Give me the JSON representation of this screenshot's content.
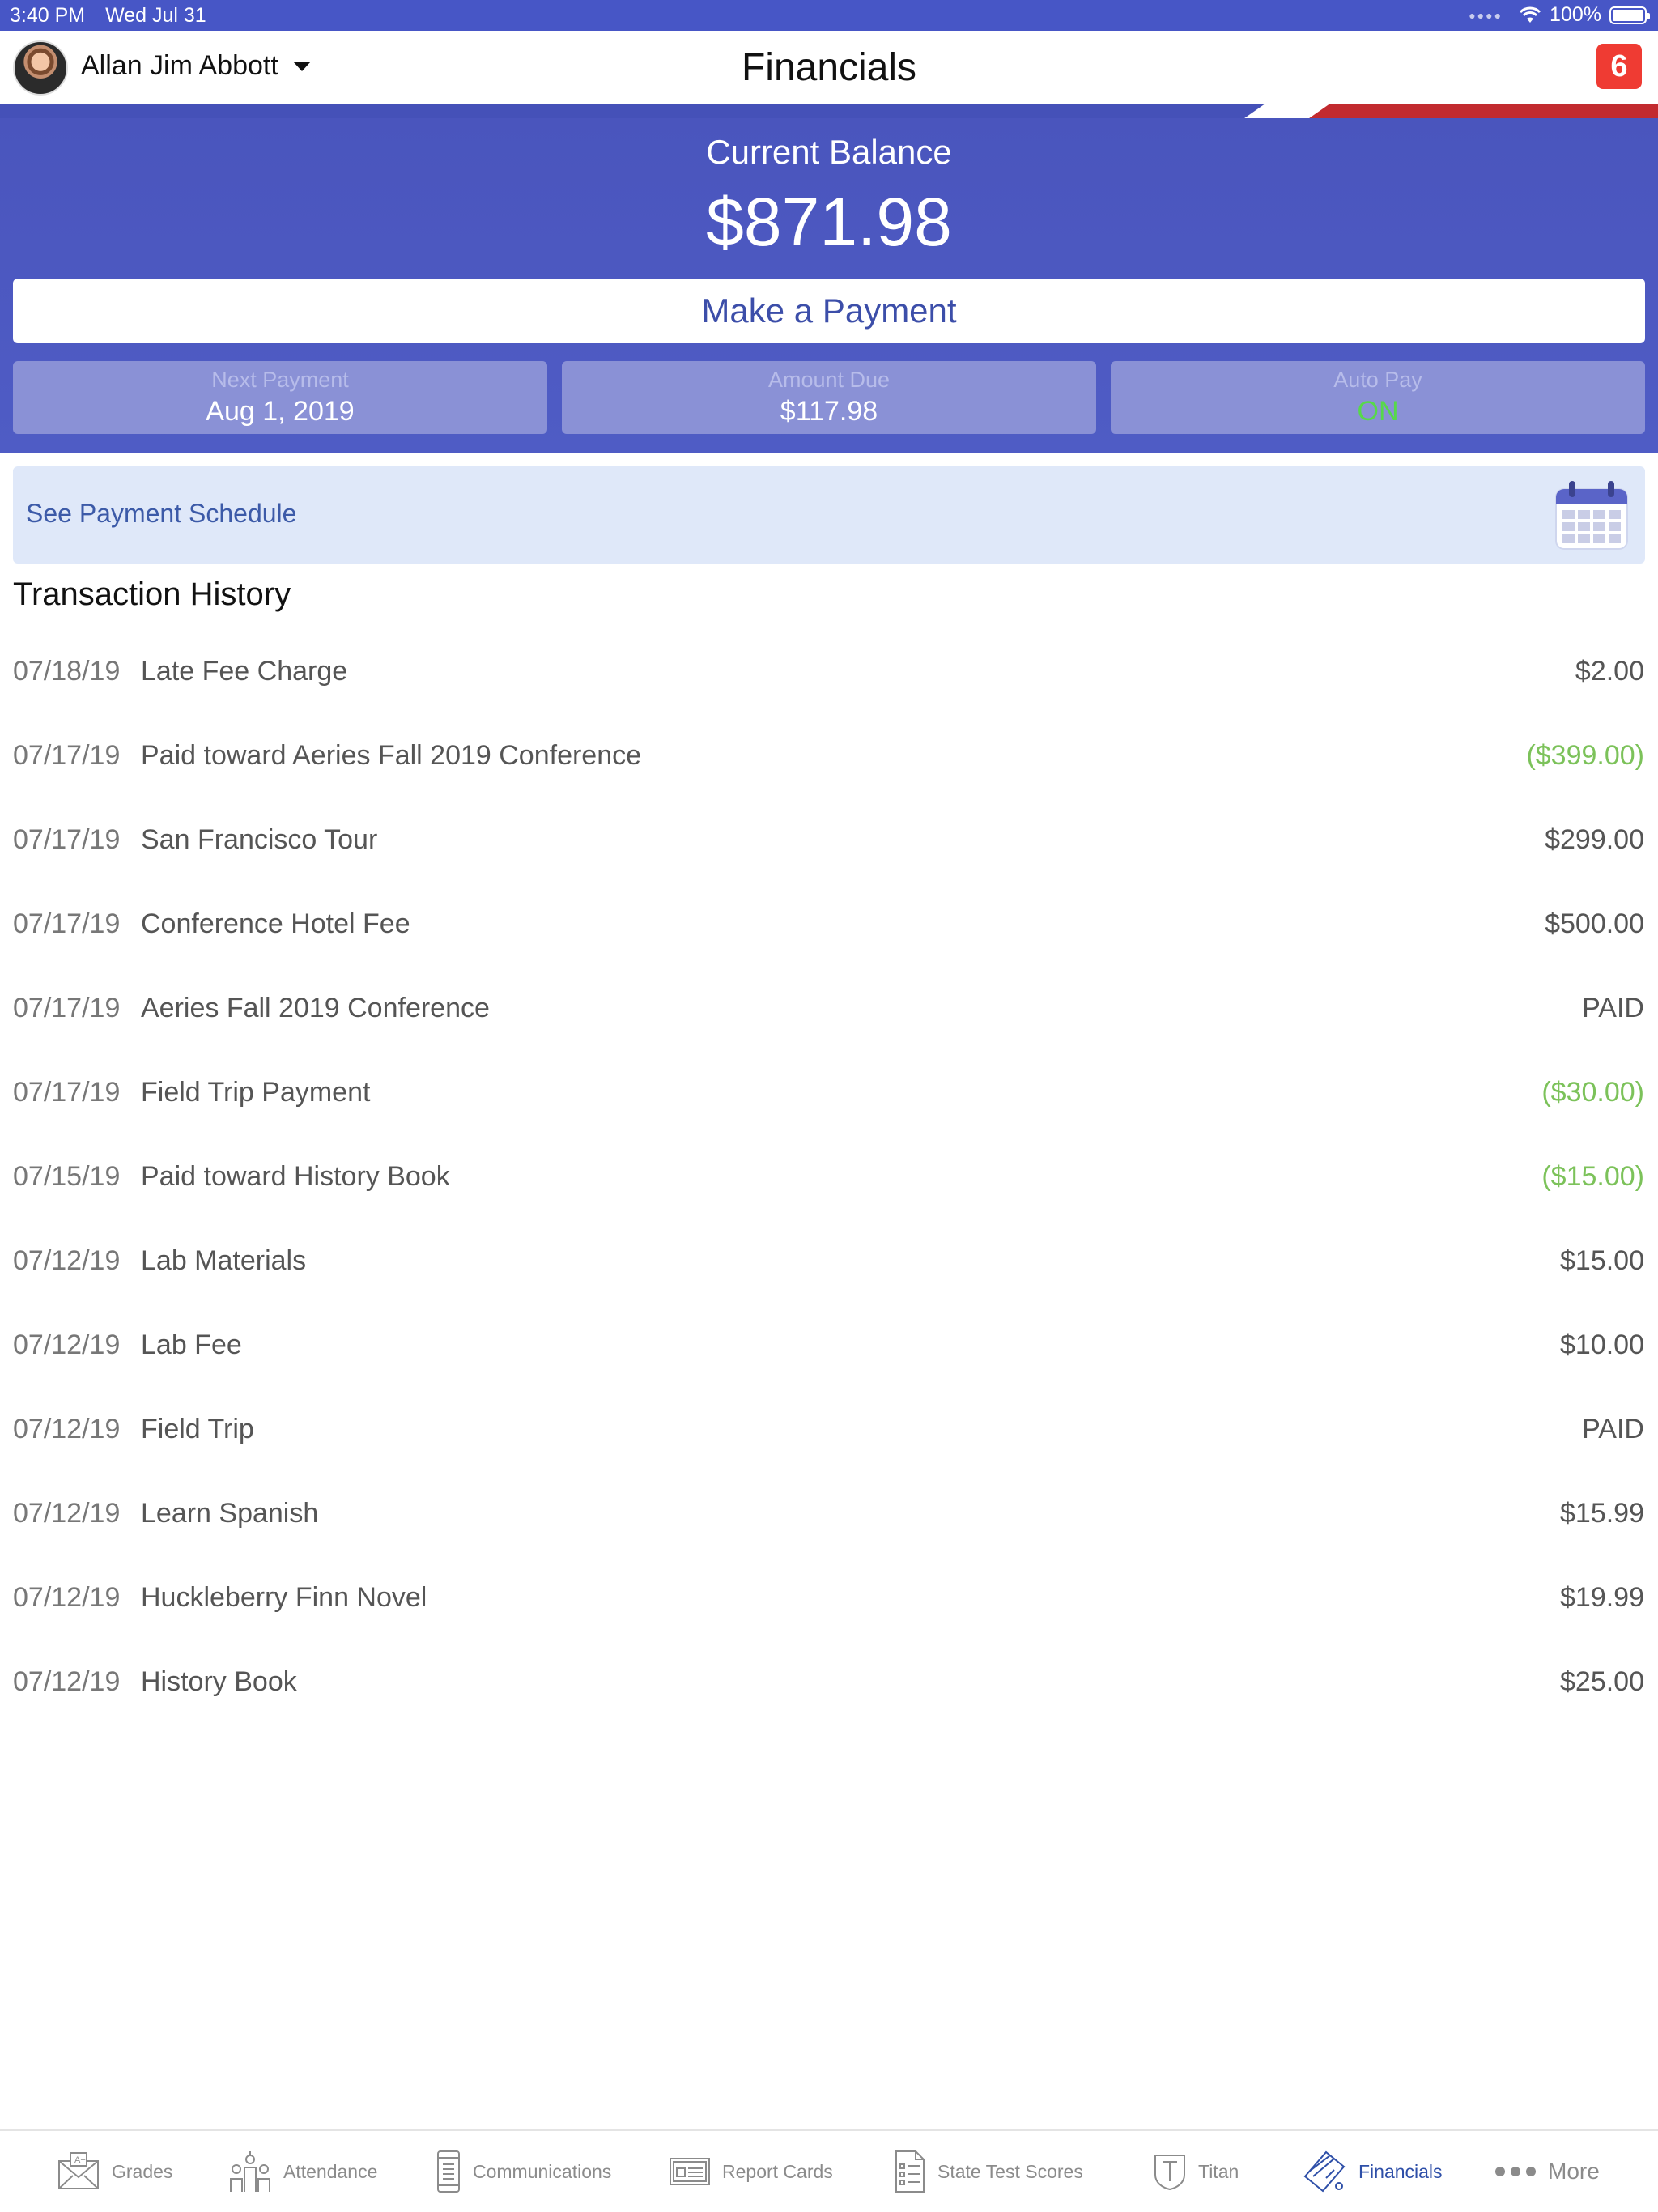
{
  "status_bar": {
    "time": "3:40 PM",
    "date": "Wed Jul 31",
    "battery": "100%"
  },
  "header": {
    "user_name": "Allan Jim Abbott",
    "title": "Financials",
    "notification_count": "6"
  },
  "balance": {
    "label": "Current Balance",
    "amount": "$871.98",
    "pay_button": "Make a Payment",
    "next_payment": {
      "label": "Next Payment",
      "value": "Aug 1, 2019"
    },
    "amount_due": {
      "label": "Amount Due",
      "value": "$117.98"
    },
    "auto_pay": {
      "label": "Auto Pay",
      "value": "ON"
    }
  },
  "schedule": {
    "label": "See Payment Schedule",
    "icon": "calendar-icon"
  },
  "history": {
    "title": "Transaction History",
    "rows": [
      {
        "date": "07/18/19",
        "desc": "Late Fee Charge",
        "amount": "$2.00",
        "credit": false
      },
      {
        "date": "07/17/19",
        "desc": "Paid toward Aeries Fall 2019 Conference",
        "amount": "($399.00)",
        "credit": true
      },
      {
        "date": "07/17/19",
        "desc": "San Francisco Tour",
        "amount": "$299.00",
        "credit": false
      },
      {
        "date": "07/17/19",
        "desc": "Conference Hotel Fee",
        "amount": "$500.00",
        "credit": false
      },
      {
        "date": "07/17/19",
        "desc": "Aeries Fall 2019 Conference",
        "amount": "PAID",
        "credit": false
      },
      {
        "date": "07/17/19",
        "desc": "Field Trip Payment",
        "amount": "($30.00)",
        "credit": true
      },
      {
        "date": "07/15/19",
        "desc": "Paid toward History Book",
        "amount": "($15.00)",
        "credit": true
      },
      {
        "date": "07/12/19",
        "desc": "Lab Materials",
        "amount": "$15.00",
        "credit": false
      },
      {
        "date": "07/12/19",
        "desc": "Lab Fee",
        "amount": "$10.00",
        "credit": false
      },
      {
        "date": "07/12/19",
        "desc": "Field Trip",
        "amount": "PAID",
        "credit": false
      },
      {
        "date": "07/12/19",
        "desc": "Learn Spanish",
        "amount": "$15.99",
        "credit": false
      },
      {
        "date": "07/12/19",
        "desc": "Huckleberry Finn Novel",
        "amount": "$19.99",
        "credit": false
      },
      {
        "date": "07/12/19",
        "desc": "History Book",
        "amount": "$25.00",
        "credit": false
      }
    ]
  },
  "tabbar": {
    "tabs": [
      {
        "label": "Grades",
        "icon": "grades-icon"
      },
      {
        "label": "Attendance",
        "icon": "attendance-icon"
      },
      {
        "label": "Communications",
        "icon": "communications-icon"
      },
      {
        "label": "Report Cards",
        "icon": "report-cards-icon"
      },
      {
        "label": "State Test Scores",
        "icon": "state-test-scores-icon"
      },
      {
        "label": "Titan",
        "icon": "titan-icon"
      },
      {
        "label": "Financials",
        "icon": "financials-icon"
      },
      {
        "label": "More",
        "icon": "more-icon"
      }
    ],
    "active": "Financials"
  },
  "colors": {
    "primary": "#4a55bd",
    "credit": "#7cc25a",
    "auto_pay_on": "#57d94a",
    "badge": "#ef3b33",
    "link": "#3c5aa8"
  }
}
